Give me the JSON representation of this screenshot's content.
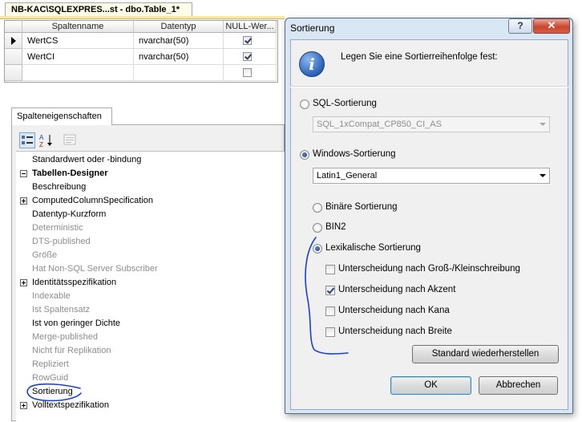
{
  "document_tab": {
    "title": "NB-KAC\\SQLEXPRES...st - dbo.Table_1*"
  },
  "grid": {
    "headers": [
      "Spaltenname",
      "Datentyp",
      "NULL-Wer..."
    ],
    "rows": [
      {
        "name": "WertCS",
        "type": "nvarchar(50)",
        "null_allowed": true,
        "current": true
      },
      {
        "name": "WertCI",
        "type": "nvarchar(50)",
        "null_allowed": true,
        "current": false
      },
      {
        "name": "",
        "type": "",
        "null_allowed": false,
        "current": false
      }
    ]
  },
  "properties": {
    "tab_label": "Spalteneigenschaften",
    "toolbar_icons": [
      "categorized-icon",
      "alphabetical-icon",
      "property-pages-icon"
    ],
    "rows": [
      {
        "label": "Standardwert oder -bindung",
        "kind": "item",
        "state": "normal"
      },
      {
        "label": "Tabellen-Designer",
        "kind": "category",
        "state": "expanded"
      },
      {
        "label": "Beschreibung",
        "kind": "item",
        "state": "normal"
      },
      {
        "label": "ComputedColumnSpecification",
        "kind": "item",
        "state": "collapsed"
      },
      {
        "label": "Datentyp-Kurzform",
        "kind": "item",
        "state": "normal"
      },
      {
        "label": "Deterministic",
        "kind": "item",
        "state": "gray"
      },
      {
        "label": "DTS-published",
        "kind": "item",
        "state": "gray"
      },
      {
        "label": "Größe",
        "kind": "item",
        "state": "gray"
      },
      {
        "label": "Hat Non-SQL Server Subscriber",
        "kind": "item",
        "state": "gray"
      },
      {
        "label": "Identitätsspezifikation",
        "kind": "item",
        "state": "collapsed"
      },
      {
        "label": "Indexable",
        "kind": "item",
        "state": "gray"
      },
      {
        "label": "Ist Spaltensatz",
        "kind": "item",
        "state": "gray"
      },
      {
        "label": "Ist von geringer Dichte",
        "kind": "item",
        "state": "normal"
      },
      {
        "label": "Merge-published",
        "kind": "item",
        "state": "gray"
      },
      {
        "label": "Nicht für Replikation",
        "kind": "item",
        "state": "gray"
      },
      {
        "label": "Repliziert",
        "kind": "item",
        "state": "gray"
      },
      {
        "label": "RowGuid",
        "kind": "item",
        "state": "gray"
      },
      {
        "label": "Sortierung",
        "kind": "item",
        "state": "normal"
      },
      {
        "label": "Volltextspezifikation",
        "kind": "item",
        "state": "collapsed"
      }
    ]
  },
  "dialog": {
    "title": "Sortierung",
    "help_label": "?",
    "close_label": "✕",
    "prompt": "Legen Sie eine Sortierreihenfolge fest:",
    "sql_sorting": {
      "label": "SQL-Sortierung",
      "selected": false,
      "combo_value": "SQL_1xCompat_CP850_CI_AS"
    },
    "windows_sorting": {
      "label": "Windows-Sortierung",
      "selected": true,
      "combo_value": "Latin1_General"
    },
    "binary_label": "Binäre Sortierung",
    "bin2_label": "BIN2",
    "lexical_label": "Lexikalische Sortierung",
    "options": [
      {
        "label": "Unterscheidung nach Groß-/Kleinschreibung",
        "checked": false
      },
      {
        "label": "Unterscheidung nach Akzent",
        "checked": true
      },
      {
        "label": "Unterscheidung nach Kana",
        "checked": false
      },
      {
        "label": "Unterscheidung nach Breite",
        "checked": false
      }
    ],
    "restore_label": "Standard wiederherstellen",
    "ok_label": "OK",
    "cancel_label": "Abbrechen"
  },
  "colors": {
    "annotation_ink": "#1a3fd1",
    "dialog_frame": "#d9e6f3",
    "tab_accent": "#f7e8a8"
  }
}
